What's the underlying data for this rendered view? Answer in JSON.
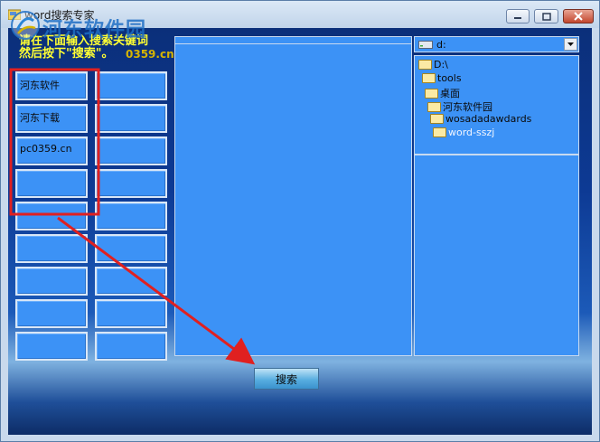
{
  "window": {
    "title": "word搜索专家",
    "controls": {
      "minimize": "minimize",
      "maximize": "maximize",
      "close": "close"
    }
  },
  "watermark": {
    "brand": "河东软件园",
    "url": "0359.cn"
  },
  "hint": {
    "line1": "请在下面输入搜索关键词",
    "line2": "然后按下\"搜索\"。"
  },
  "keywords": [
    "河东软件",
    "",
    "河东下载",
    "",
    "pc0359.cn",
    "",
    "",
    "",
    "",
    "",
    "",
    "",
    "",
    "",
    "",
    "",
    "",
    ""
  ],
  "drive": {
    "selected": "d:"
  },
  "tree": [
    "D:\\",
    "tools",
    "桌面",
    "河东软件园",
    "wosadadawdards",
    "word-sszj"
  ],
  "search_button": {
    "label": "搜索"
  },
  "colors": {
    "field": "#3c92f6",
    "hint": "#ffff33",
    "annotation": "#e02020"
  }
}
